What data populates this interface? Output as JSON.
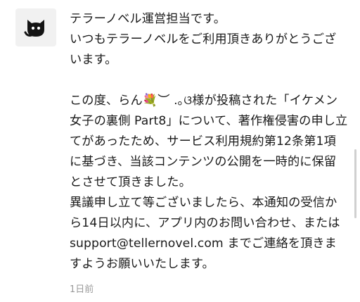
{
  "message": {
    "greeting_line1": "テラーノベル運営担当です。",
    "greeting_line2": "いつもテラーノベルをご利用頂きありがとうございます。",
    "body_para1": "この度、らん💐︶ .｡ଓ様が投稿された「イケメン女子の裏側 Part8」について、著作権侵害の申し立てがあったため、サービス利用規約第12条第1項に基づき、当該コンテンツの公開を一時的に保留とさせて頂きました。",
    "body_para2": "異議申し立て等ございましたら、本通知の受信から14日以内に、アプリ内のお問い合わせ、または support@tellernovel.com までご連絡を頂きますようお願いいたします。",
    "timestamp": "1日前"
  },
  "icons": {
    "avatar": "black-cat-icon"
  }
}
